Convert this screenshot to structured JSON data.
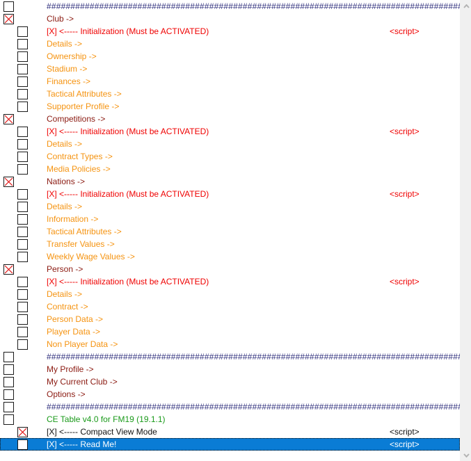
{
  "window": {
    "title": "CE Table v4.0 for FM19 (19.1.1)",
    "accent_selected_bg": "#0a7cd5",
    "colors": {
      "maroon": "#8b1a11",
      "red": "#ef0000",
      "orange": "#f59310",
      "green": "#1a9a1a",
      "black": "#101010",
      "navy": "#2b2b7a"
    }
  },
  "separator": {
    "text": "########################################################################################"
  },
  "script_label": "<script>",
  "rows": [
    {
      "kind": "separator",
      "checkbox": "unchecked",
      "level": 1,
      "label": "########################################################################################",
      "color": "navy",
      "script": "",
      "selected": false
    },
    {
      "kind": "item",
      "checkbox": "checked",
      "level": 1,
      "label": "Club ->",
      "color": "maroon",
      "script": "",
      "selected": false
    },
    {
      "kind": "item",
      "checkbox": "unchecked",
      "level": 2,
      "label": "[X] <----- Initialization (Must be ACTIVATED)",
      "color": "red",
      "script": "<script>",
      "script_color": "red",
      "selected": false
    },
    {
      "kind": "item",
      "checkbox": "unchecked",
      "level": 2,
      "label": "Details ->",
      "color": "orange",
      "script": "",
      "selected": false
    },
    {
      "kind": "item",
      "checkbox": "unchecked",
      "level": 2,
      "label": "Ownership ->",
      "color": "orange",
      "script": "",
      "selected": false
    },
    {
      "kind": "item",
      "checkbox": "unchecked",
      "level": 2,
      "label": "Stadium ->",
      "color": "orange",
      "script": "",
      "selected": false
    },
    {
      "kind": "item",
      "checkbox": "unchecked",
      "level": 2,
      "label": "Finances ->",
      "color": "orange",
      "script": "",
      "selected": false
    },
    {
      "kind": "item",
      "checkbox": "unchecked",
      "level": 2,
      "label": "Tactical Attributes ->",
      "color": "orange",
      "script": "",
      "selected": false
    },
    {
      "kind": "item",
      "checkbox": "unchecked",
      "level": 2,
      "label": "Supporter Profile ->",
      "color": "orange",
      "script": "",
      "selected": false
    },
    {
      "kind": "item",
      "checkbox": "checked",
      "level": 1,
      "label": "Competitions ->",
      "color": "maroon",
      "script": "",
      "selected": false
    },
    {
      "kind": "item",
      "checkbox": "unchecked",
      "level": 2,
      "label": "[X] <----- Initialization (Must be ACTIVATED)",
      "color": "red",
      "script": "<script>",
      "script_color": "red",
      "selected": false
    },
    {
      "kind": "item",
      "checkbox": "unchecked",
      "level": 2,
      "label": "Details ->",
      "color": "orange",
      "script": "",
      "selected": false
    },
    {
      "kind": "item",
      "checkbox": "unchecked",
      "level": 2,
      "label": "Contract Types ->",
      "color": "orange",
      "script": "",
      "selected": false
    },
    {
      "kind": "item",
      "checkbox": "unchecked",
      "level": 2,
      "label": "Media Policies ->",
      "color": "orange",
      "script": "",
      "selected": false
    },
    {
      "kind": "item",
      "checkbox": "checked",
      "level": 1,
      "label": "Nations ->",
      "color": "maroon",
      "script": "",
      "selected": false
    },
    {
      "kind": "item",
      "checkbox": "unchecked",
      "level": 2,
      "label": "[X] <----- Initialization (Must be ACTIVATED)",
      "color": "red",
      "script": "<script>",
      "script_color": "red",
      "selected": false
    },
    {
      "kind": "item",
      "checkbox": "unchecked",
      "level": 2,
      "label": "Details ->",
      "color": "orange",
      "script": "",
      "selected": false
    },
    {
      "kind": "item",
      "checkbox": "unchecked",
      "level": 2,
      "label": "Information ->",
      "color": "orange",
      "script": "",
      "selected": false
    },
    {
      "kind": "item",
      "checkbox": "unchecked",
      "level": 2,
      "label": "Tactical Attributes ->",
      "color": "orange",
      "script": "",
      "selected": false
    },
    {
      "kind": "item",
      "checkbox": "unchecked",
      "level": 2,
      "label": "Transfer Values ->",
      "color": "orange",
      "script": "",
      "selected": false
    },
    {
      "kind": "item",
      "checkbox": "unchecked",
      "level": 2,
      "label": "Weekly Wage Values ->",
      "color": "orange",
      "script": "",
      "selected": false
    },
    {
      "kind": "item",
      "checkbox": "checked",
      "level": 1,
      "label": "Person ->",
      "color": "maroon",
      "script": "",
      "selected": false
    },
    {
      "kind": "item",
      "checkbox": "unchecked",
      "level": 2,
      "label": "[X] <----- Initialization (Must be ACTIVATED)",
      "color": "red",
      "script": "<script>",
      "script_color": "red",
      "selected": false
    },
    {
      "kind": "item",
      "checkbox": "unchecked",
      "level": 2,
      "label": "Details ->",
      "color": "orange",
      "script": "",
      "selected": false
    },
    {
      "kind": "item",
      "checkbox": "unchecked",
      "level": 2,
      "label": "Contract ->",
      "color": "orange",
      "script": "",
      "selected": false
    },
    {
      "kind": "item",
      "checkbox": "unchecked",
      "level": 2,
      "label": "Person Data ->",
      "color": "orange",
      "script": "",
      "selected": false
    },
    {
      "kind": "item",
      "checkbox": "unchecked",
      "level": 2,
      "label": "Player Data ->",
      "color": "orange",
      "script": "",
      "selected": false
    },
    {
      "kind": "item",
      "checkbox": "unchecked",
      "level": 2,
      "label": "Non Player Data ->",
      "color": "orange",
      "script": "",
      "selected": false
    },
    {
      "kind": "separator",
      "checkbox": "unchecked",
      "level": 1,
      "label": "########################################################################################",
      "color": "navy",
      "script": "",
      "selected": false
    },
    {
      "kind": "item",
      "checkbox": "unchecked",
      "level": 1,
      "label": "My Profile ->",
      "color": "maroon",
      "script": "",
      "selected": false
    },
    {
      "kind": "item",
      "checkbox": "unchecked",
      "level": 1,
      "label": "My Current Club ->",
      "color": "maroon",
      "script": "",
      "selected": false
    },
    {
      "kind": "item",
      "checkbox": "unchecked",
      "level": 1,
      "label": "Options ->",
      "color": "maroon",
      "script": "",
      "selected": false
    },
    {
      "kind": "separator",
      "checkbox": "unchecked",
      "level": 1,
      "label": "########################################################################################",
      "color": "navy",
      "script": "",
      "selected": false
    },
    {
      "kind": "item",
      "checkbox": "unchecked",
      "level": 1,
      "label": "CE Table v4.0 for FM19 (19.1.1)",
      "color": "green",
      "script": "",
      "selected": false
    },
    {
      "kind": "item",
      "checkbox": "checked",
      "level": 2,
      "label": "[X] <----- Compact View Mode",
      "color": "black",
      "script": "<script>",
      "script_color": "black",
      "selected": false
    },
    {
      "kind": "item",
      "checkbox": "unchecked",
      "level": 2,
      "label": "[X] <----- Read Me!",
      "color": "black",
      "script": "<script>",
      "script_color": "black",
      "selected": true
    }
  ],
  "scrollbar": {
    "up_arrow": "scroll-up-chevron",
    "down_arrow": "scroll-down-chevron"
  }
}
